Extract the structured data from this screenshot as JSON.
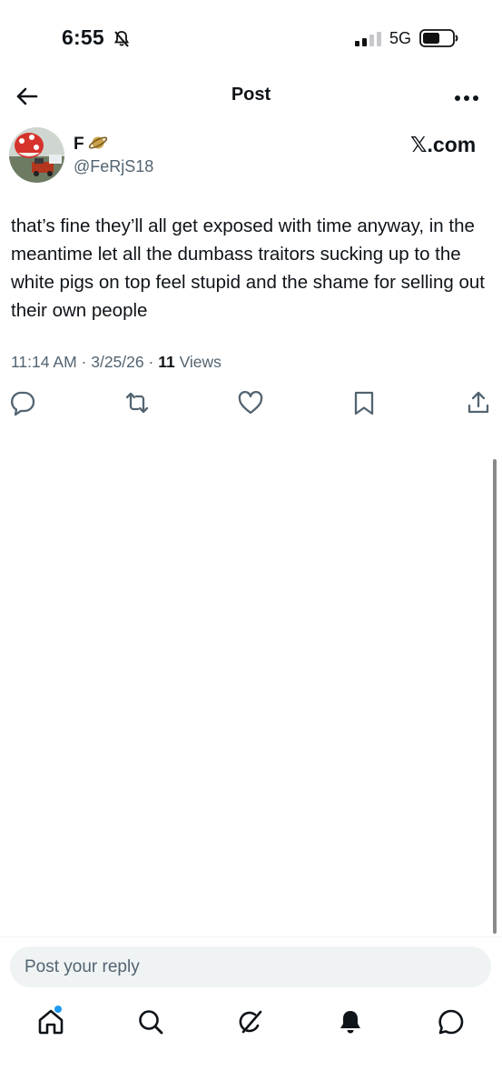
{
  "status_bar": {
    "time": "6:55",
    "network": "5G"
  },
  "header": {
    "title": "Post"
  },
  "post": {
    "display_name": "F",
    "handle": "@FeRjS18",
    "source": "𝕏.com",
    "text": "that’s fine they’ll all get exposed with time anyway, in the meantime let all the dumbass traitors sucking up to the white pigs on top feel stupid and the shame for selling out their own people",
    "time": "11:14 AM",
    "date": "3/25/26",
    "views_count": "11",
    "views_label": "Views"
  },
  "reply": {
    "placeholder": "Post your reply"
  },
  "icons": {
    "back": "arrow-left-icon",
    "more": "more-horizontal-icon",
    "reply": "comment-icon",
    "repost": "repost-icon",
    "like": "heart-icon",
    "bookmark": "bookmark-icon",
    "share": "share-icon",
    "home": "home-icon",
    "search": "search-icon",
    "grok": "grok-icon",
    "notifications": "bell-icon",
    "messages": "chat-icon"
  },
  "colors": {
    "text": "#0f1419",
    "secondary": "#536471",
    "accent": "#1d9bf0",
    "input_bg": "#eff3f4"
  }
}
